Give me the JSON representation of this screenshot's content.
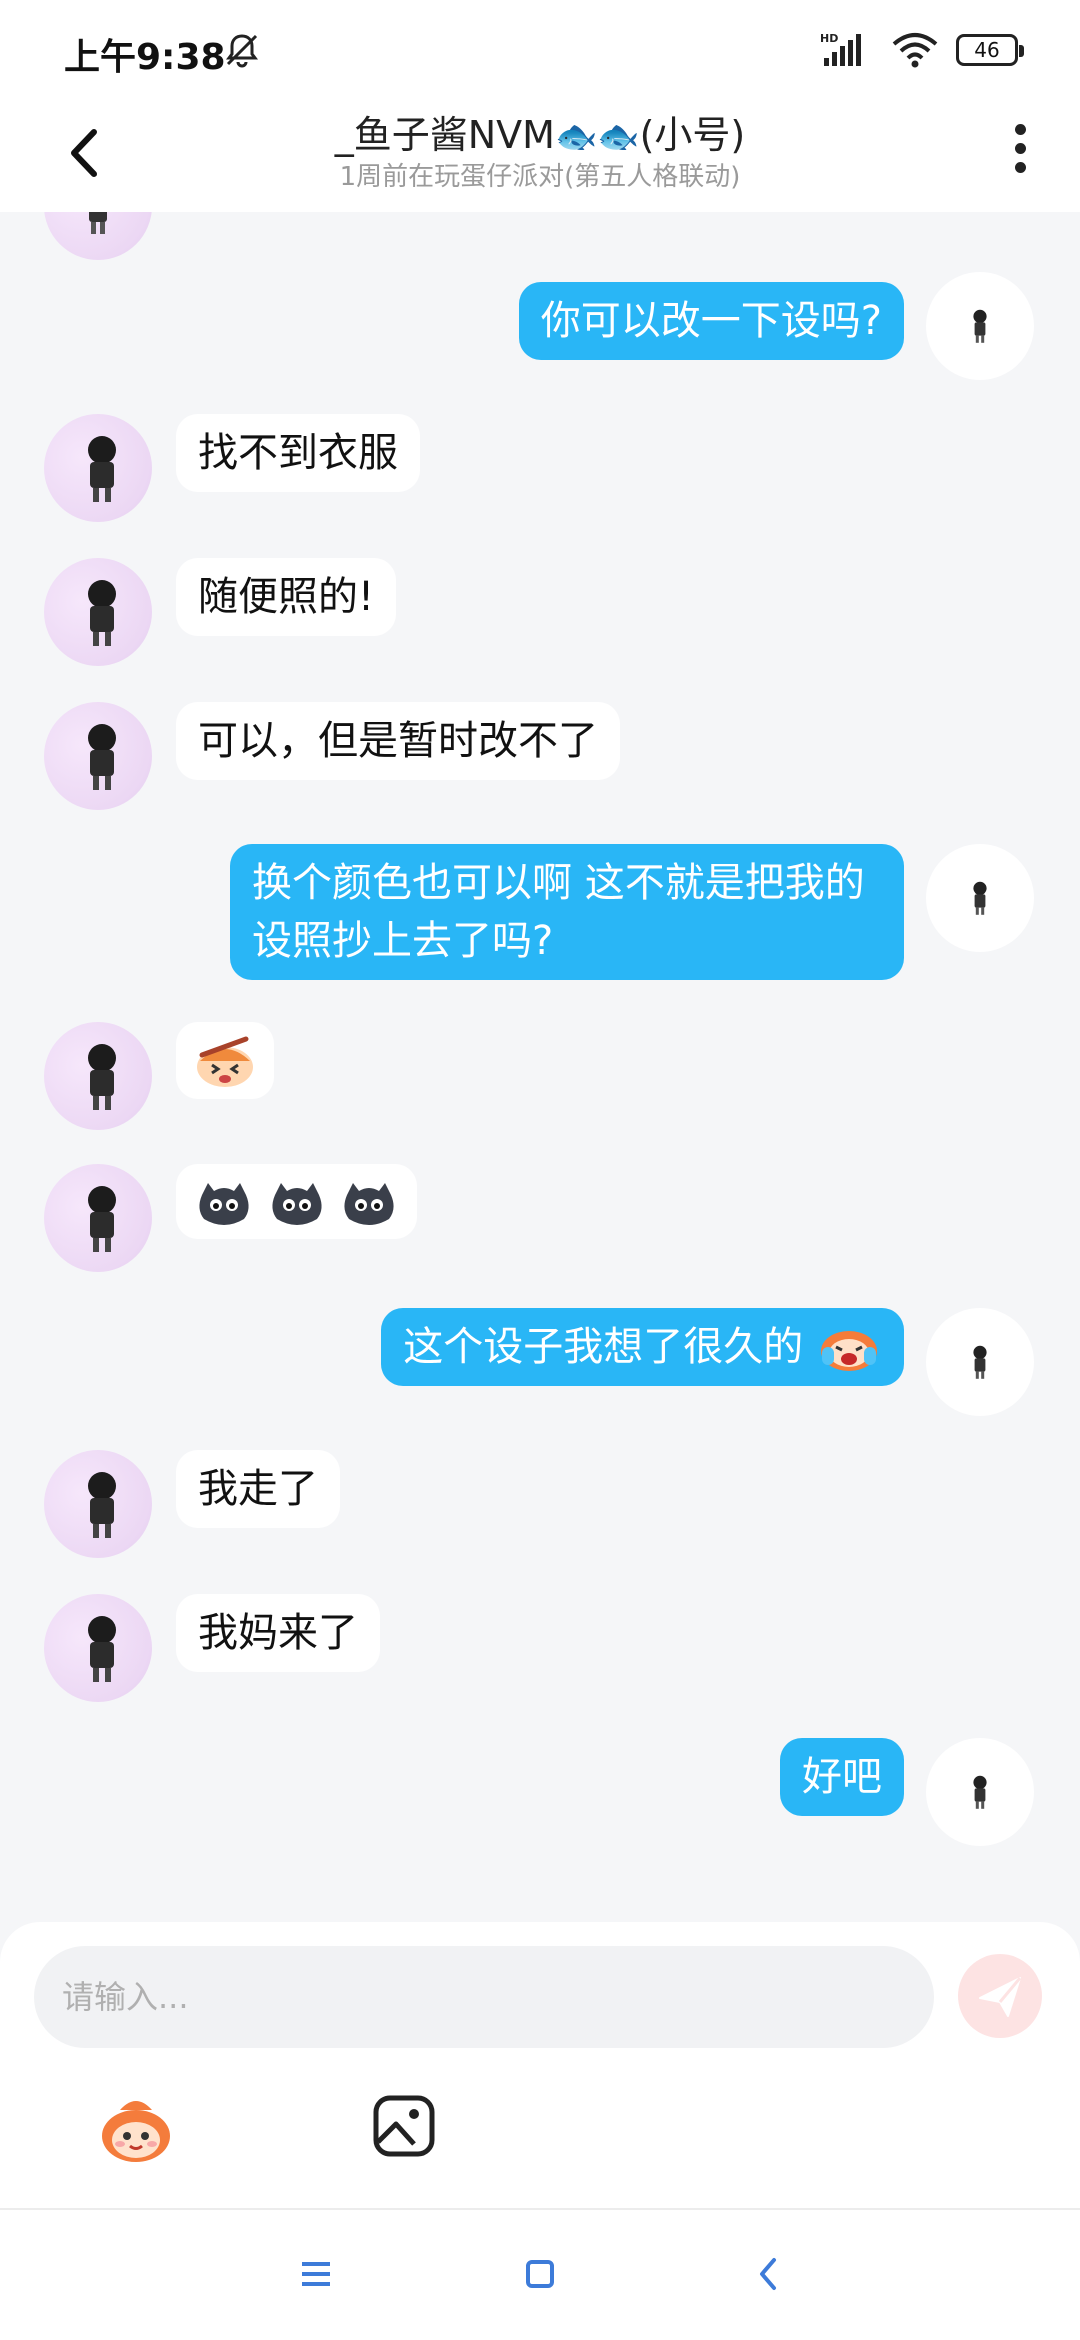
{
  "status_bar": {
    "time": "上午9:38",
    "battery": "46",
    "icons": [
      "bell-off-icon",
      "hd-signal-icon",
      "wifi-icon",
      "battery-icon"
    ]
  },
  "header": {
    "title": "_鱼子酱NVM",
    "title_emoji": "🐟🐟",
    "title_suffix": "(小号)",
    "subtitle": "1周前在玩蛋仔派对(第五人格联动)"
  },
  "messages": [
    {
      "side": "out",
      "text": "你可以改一下设吗?"
    },
    {
      "side": "in",
      "text": "找不到衣服"
    },
    {
      "side": "in",
      "text": "随便照的!"
    },
    {
      "side": "in",
      "text": "可以，但是暂时改不了"
    },
    {
      "side": "out",
      "text": "换个颜色也可以啊 这不就是把我的设照抄上去了吗?"
    },
    {
      "side": "in",
      "text": "",
      "sticker": "sweat-face-emoji"
    },
    {
      "side": "in",
      "text": "",
      "sticker": "dark-face-emoji-x3"
    },
    {
      "side": "out",
      "text": "这个设子我想了很久的",
      "trailing_emoji": "crying-face-emoji"
    },
    {
      "side": "in",
      "text": "我走了"
    },
    {
      "side": "in",
      "text": "我妈来了"
    },
    {
      "side": "out",
      "text": "好吧"
    }
  ],
  "input": {
    "placeholder": "请输入..."
  },
  "colors": {
    "outgoing_bubble": "#29b6f6",
    "incoming_bubble": "#ffffff",
    "background": "#f5f6f8",
    "send_button": "#fde3e3"
  }
}
